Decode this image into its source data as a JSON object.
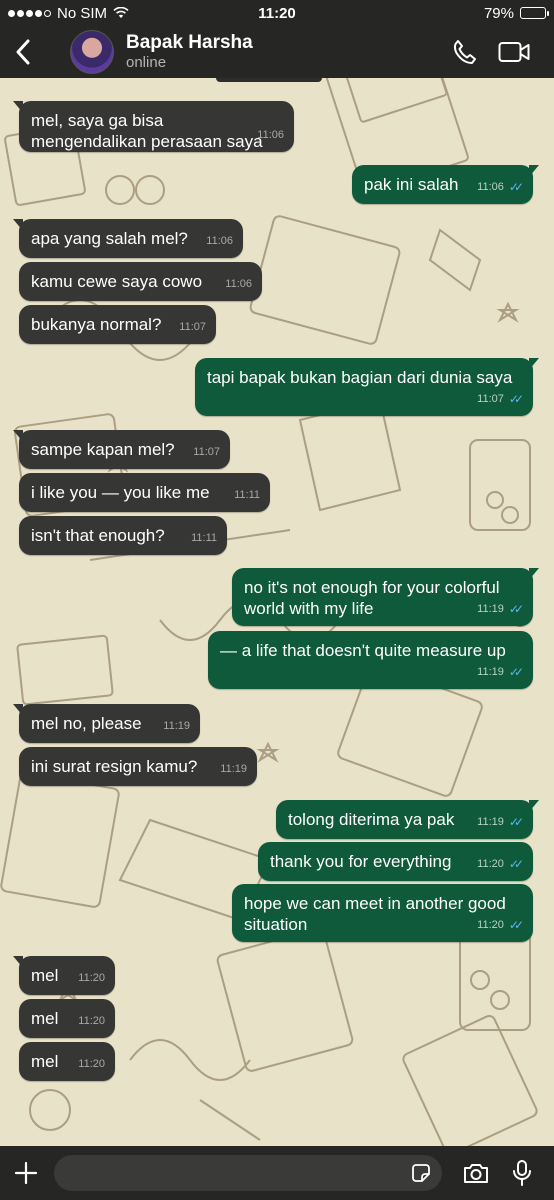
{
  "status_bar": {
    "carrier": "No SIM",
    "time": "11:20",
    "battery": "79%",
    "battery_level": 0.79
  },
  "header": {
    "contact_name": "Bapak Harsha",
    "contact_status": "online"
  },
  "messages": [
    {
      "dir": "in",
      "text": "mel, saya ga bisa mengendalikan perasaan saya",
      "time": "11:06"
    },
    {
      "dir": "out",
      "text": "pak ini salah",
      "time": "11:06",
      "read": true
    },
    {
      "dir": "in",
      "text": "apa yang salah mel?",
      "time": "11:06"
    },
    {
      "dir": "in",
      "text": "kamu cewe saya cowo",
      "time": "11:06"
    },
    {
      "dir": "in",
      "text": "bukanya normal?",
      "time": "11:07"
    },
    {
      "dir": "out",
      "text": "tapi bapak bukan bagian dari dunia saya",
      "time": "11:07",
      "read": true
    },
    {
      "dir": "in",
      "text": "sampe kapan mel?",
      "time": "11:07"
    },
    {
      "dir": "in",
      "text": "i like you — you like me",
      "time": "11:11"
    },
    {
      "dir": "in",
      "text": "isn't that enough?",
      "time": "11:11"
    },
    {
      "dir": "out",
      "text": "no it's not enough for your colorful world with my life",
      "time": "11:19",
      "read": true
    },
    {
      "dir": "out",
      "text": "— a life that doesn't quite measure up",
      "time": "11:19",
      "read": true
    },
    {
      "dir": "in",
      "text": "mel no, please",
      "time": "11:19"
    },
    {
      "dir": "in",
      "text": "ini surat resign kamu?",
      "time": "11:19"
    },
    {
      "dir": "out",
      "text": "tolong diterima ya pak",
      "time": "11:19",
      "read": true
    },
    {
      "dir": "out",
      "text": "thank you for everything",
      "time": "11:20",
      "read": true
    },
    {
      "dir": "out",
      "text": "hope we can meet in another good situation",
      "time": "11:20",
      "read": true
    },
    {
      "dir": "in",
      "text": "mel",
      "time": "11:20"
    },
    {
      "dir": "in",
      "text": "mel",
      "time": "11:20"
    },
    {
      "dir": "in",
      "text": "mel",
      "time": "11:20"
    }
  ],
  "icons": {
    "back": "chevron-left-icon",
    "call": "phone-icon",
    "video": "video-camera-icon",
    "attach": "plus-icon",
    "sticker": "sticker-icon",
    "camera": "camera-icon",
    "mic": "microphone-icon"
  },
  "colors": {
    "bar_bg": "#262624",
    "incoming_bubble": "#363635",
    "outgoing_bubble": "#0e5a3a",
    "read_ticks": "#5bb8f6",
    "wallpaper": "#e8e2c8"
  }
}
